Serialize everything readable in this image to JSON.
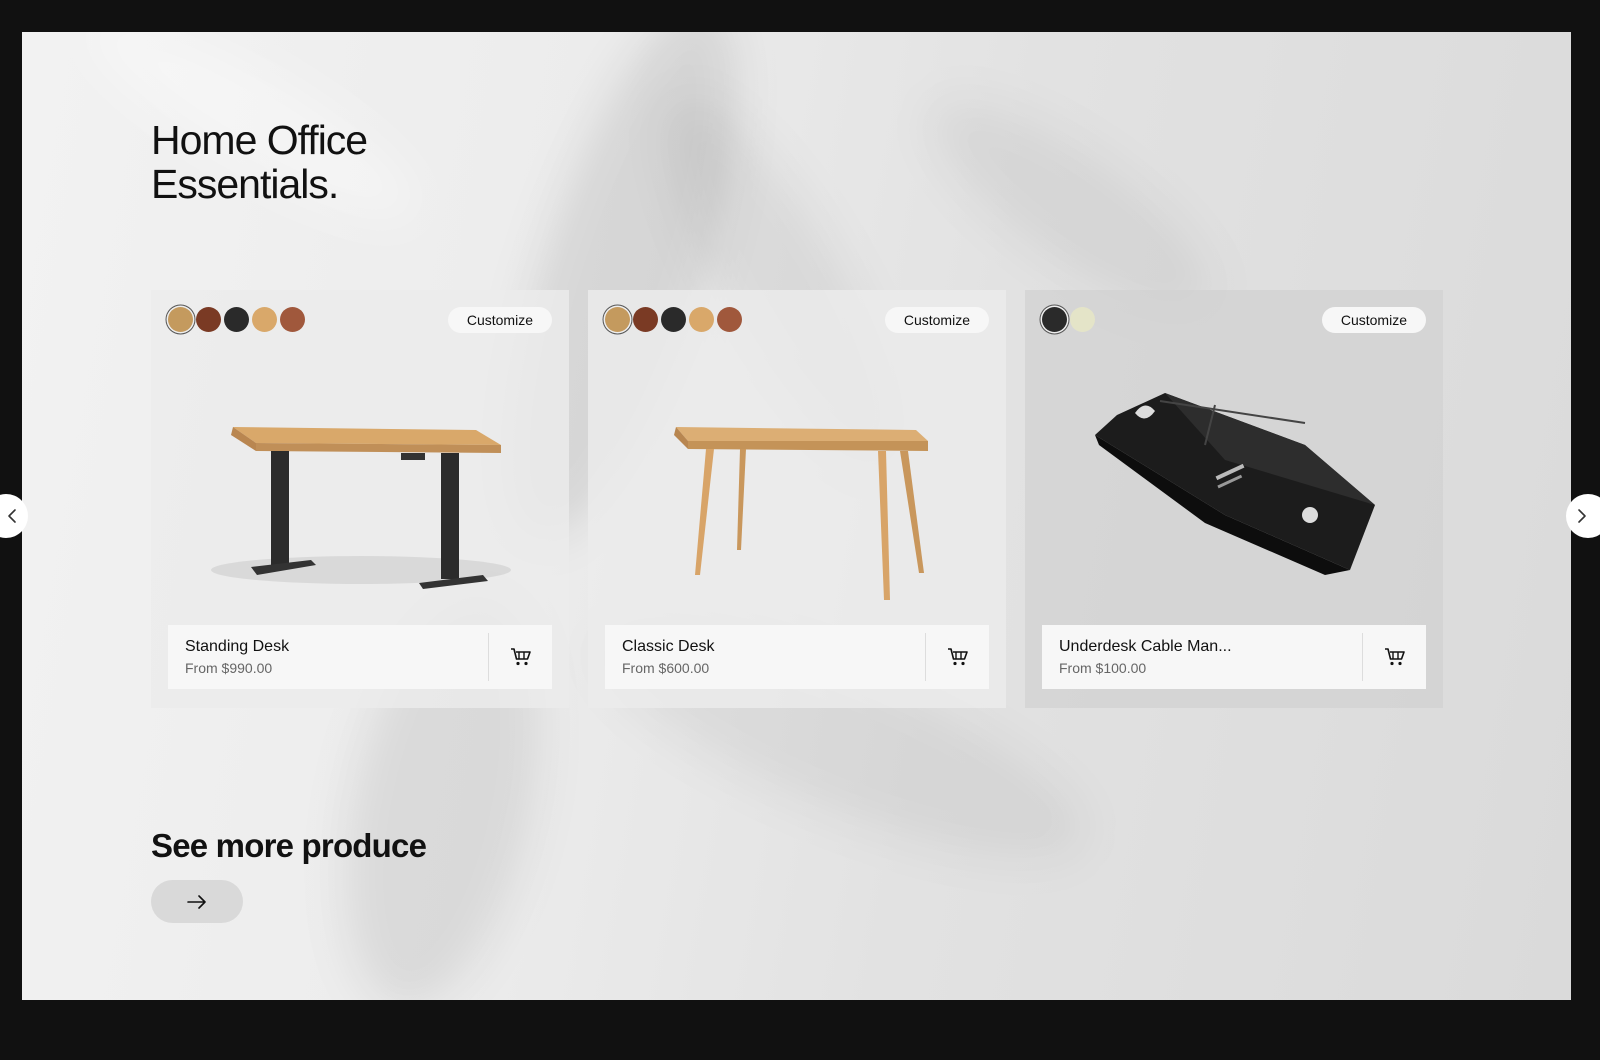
{
  "section": {
    "title_line1": "Home Office",
    "title_line2": "Essentials."
  },
  "products": [
    {
      "name": "Standing Desk",
      "price": "From $990.00",
      "customize_label": "Customize",
      "swatches": [
        "#c49a5e",
        "#7a3a24",
        "#2a2a2a",
        "#d9a86a",
        "#a0583c"
      ]
    },
    {
      "name": "Classic Desk",
      "price": "From $600.00",
      "customize_label": "Customize",
      "swatches": [
        "#c49a5e",
        "#7a3a24",
        "#2a2a2a",
        "#d9a86a",
        "#a0583c"
      ]
    },
    {
      "name": "Underdesk Cable Man...",
      "price": "From $100.00",
      "customize_label": "Customize",
      "swatches": [
        "#2a2a2a",
        "#e4e4c8"
      ]
    }
  ],
  "more": {
    "title": "See more produce"
  }
}
